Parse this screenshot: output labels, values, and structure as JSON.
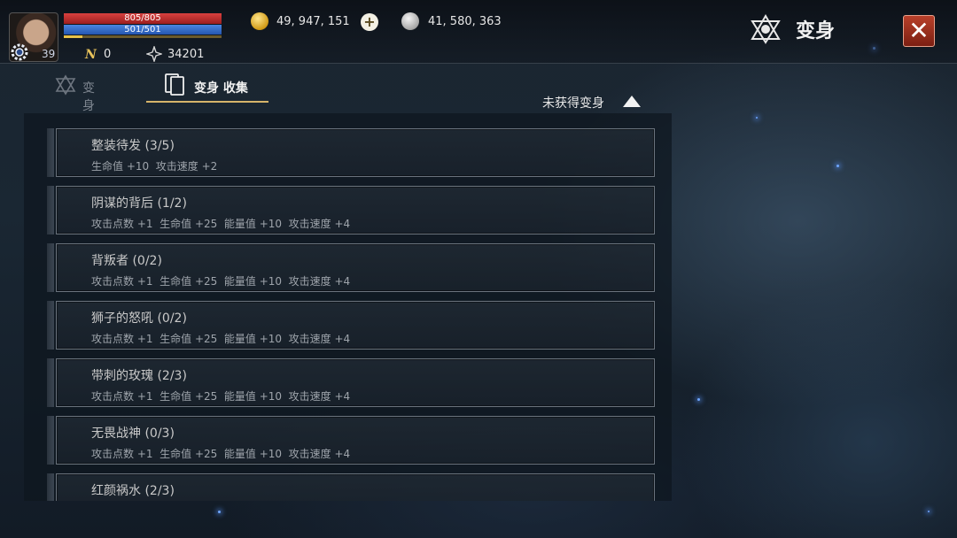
{
  "player": {
    "hp_text": "805/805",
    "mp_text": "501/501",
    "level": "39",
    "n_points": "0",
    "power": "34201"
  },
  "currency": {
    "gold": "49, 947, 151",
    "silver": "41, 580, 363"
  },
  "header": {
    "title": "变身",
    "close_label": "✕"
  },
  "tabs": [
    {
      "label": "变身",
      "active": false
    },
    {
      "label": "变身 收集",
      "active": true
    }
  ],
  "filter": {
    "label": "未获得变身"
  },
  "collections": [
    {
      "name": "整装待发 (3/5)",
      "stats": "生命值 +10  攻击速度 +2"
    },
    {
      "name": "阴谋的背后 (1/2)",
      "stats": "攻击点数 +1  生命值 +25  能量值 +10  攻击速度 +4"
    },
    {
      "name": "背叛者 (0/2)",
      "stats": "攻击点数 +1  生命值 +25  能量值 +10  攻击速度 +4"
    },
    {
      "name": "狮子的怒吼 (0/2)",
      "stats": "攻击点数 +1  生命值 +25  能量值 +10  攻击速度 +4"
    },
    {
      "name": "带刺的玫瑰 (2/3)",
      "stats": "攻击点数 +1  生命值 +25  能量值 +10  攻击速度 +4"
    },
    {
      "name": "无畏战神 (0/3)",
      "stats": "攻击点数 +1  生命值 +25  能量值 +10  攻击速度 +4"
    },
    {
      "name": "红颜祸水 (2/3)",
      "stats": ""
    }
  ],
  "colors": {
    "hp": "#d8403e",
    "mp": "#4a86e0",
    "close_button": "#b8402a",
    "active_tab_underline": "#d6b46a"
  },
  "icons": [
    "gear-icon",
    "n-currency-icon",
    "power-icon",
    "gold-coin-icon",
    "plus-icon",
    "silver-coin-icon",
    "transform-emblem-icon",
    "close-icon",
    "collection-cards-icon",
    "sort-arrow-up-icon"
  ]
}
